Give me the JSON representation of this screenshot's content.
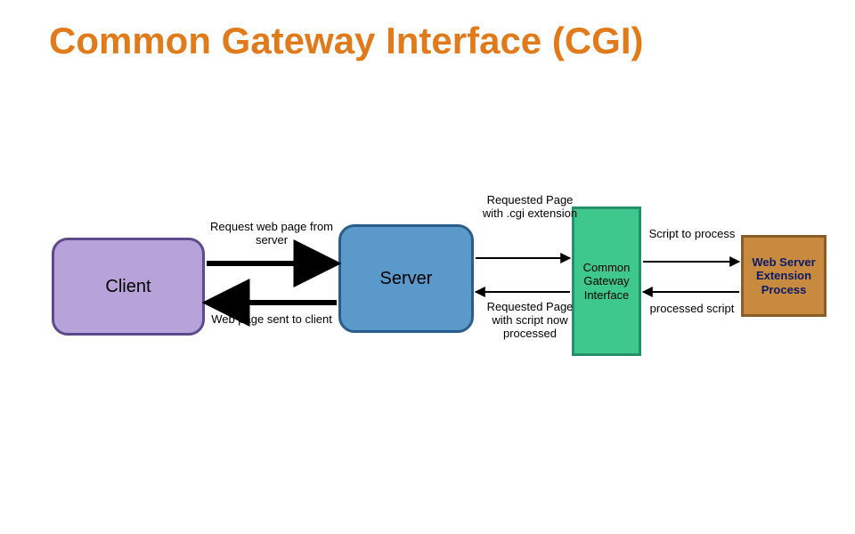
{
  "title": "Common Gateway Interface (CGI)",
  "nodes": {
    "client": "Client",
    "server": "Server",
    "cgi": "Common Gateway Interface",
    "ext": "Web Server Extension Process"
  },
  "edges": {
    "client_to_server": "Request web page from server",
    "server_to_client": "Web page sent to client",
    "server_to_cgi": "Requested Page with .cgi extension",
    "cgi_to_server": "Requested Page with script now processed",
    "cgi_to_ext": "Script to process",
    "ext_to_cgi": "processed script"
  }
}
